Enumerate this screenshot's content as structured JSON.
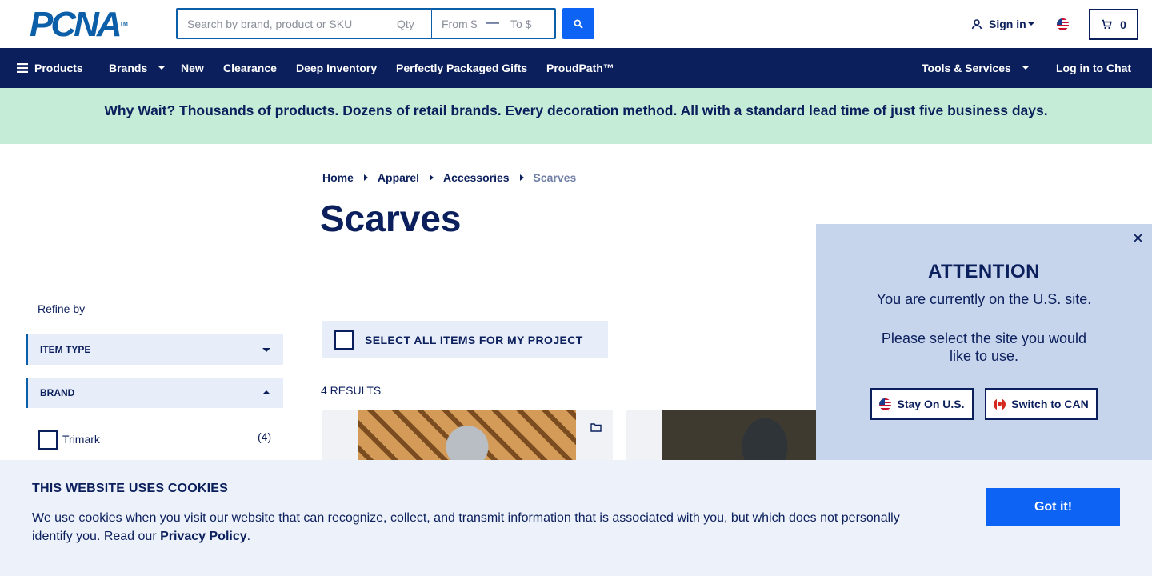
{
  "header": {
    "logo_text": "PCNA",
    "logo_tm": "TM",
    "search": {
      "placeholder": "Search by brand, product or SKU"
    },
    "qty": {
      "placeholder": "Qty"
    },
    "price_from": {
      "placeholder": "From $"
    },
    "price_dash": "—",
    "price_to": {
      "placeholder": "To $"
    },
    "sign_in_label": "Sign in",
    "cart_count": "0"
  },
  "nav": {
    "products": "Products",
    "brands": "Brands",
    "new": "New",
    "clearance": "Clearance",
    "deep_inventory": "Deep Inventory",
    "gifts": "Perfectly Packaged Gifts",
    "proudpath": "ProudPath™",
    "tools": "Tools & Services",
    "chat": "Log in to Chat"
  },
  "promo": {
    "text": "Why Wait? Thousands of products. Dozens of retail brands. Every decoration method. All with a standard lead time of just five business days."
  },
  "breadcrumb": [
    "Home",
    "Apparel",
    "Accessories",
    "Scarves"
  ],
  "page_title": "Scarves",
  "sidebar": {
    "refine_label": "Refine by",
    "facets": [
      {
        "label": "ITEM TYPE",
        "expanded": false
      },
      {
        "label": "BRAND",
        "expanded": true
      }
    ],
    "brand_options": [
      {
        "label": "Trimark",
        "count": "(4)"
      }
    ]
  },
  "main": {
    "select_all_label": "SELECT ALL ITEMS FOR MY PROJECT",
    "results_label": "4 RESULTS"
  },
  "attention": {
    "title": "ATTENTION",
    "line1": "You are currently on the U.S. site.",
    "line2": "Please select the site you would like to use.",
    "stay_label": "Stay On U.S.",
    "switch_label": "Switch to CAN"
  },
  "cookie": {
    "title": "THIS WEBSITE USES COOKIES",
    "text": "We use cookies when you visit our website that can recognize, collect, and transmit information that is associated with you, but which does not personally identify you. Read our",
    "link": "Privacy Policy",
    "end": ".",
    "button": "Got it!"
  },
  "colors": {
    "navy": "#0b1f5c",
    "brand_blue": "#0d63f3",
    "promo_green": "#c5ecd6",
    "popup_bg": "#c6d5ec",
    "cookie_bg": "#ecf1fa"
  }
}
